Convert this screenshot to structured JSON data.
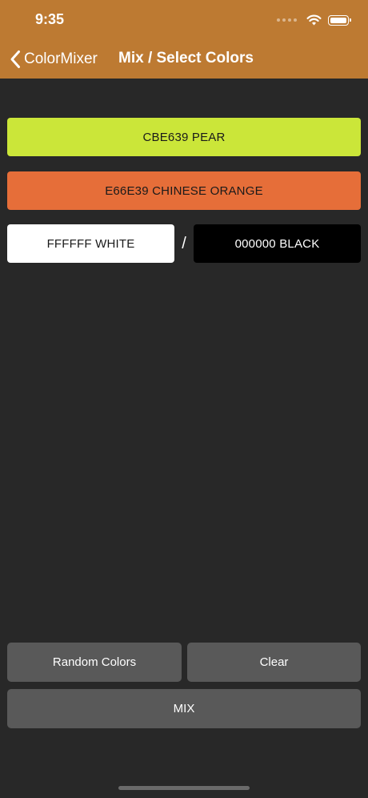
{
  "status_bar": {
    "time": "9:35"
  },
  "nav": {
    "back_label": "ColorMixer",
    "title": "Mix / Select Colors",
    "background": "#bd7a32"
  },
  "colors": {
    "first": {
      "label": "CBE639 PEAR",
      "hex": "#cbe639",
      "text_color": "#1a1a1a"
    },
    "second": {
      "label": "E66E39 CHINESE ORANGE",
      "hex": "#e66e39",
      "text_color": "#1a1a1a"
    },
    "white": {
      "label": "FFFFFF WHITE",
      "hex": "#ffffff",
      "text_color": "#1a1a1a"
    },
    "separator": "/",
    "black": {
      "label": "000000 BLACK",
      "hex": "#000000",
      "text_color": "#ffffff"
    }
  },
  "actions": {
    "random_label": "Random Colors",
    "clear_label": "Clear",
    "mix_label": "MIX",
    "button_color": "#595959"
  },
  "icons": {
    "back": "chevron-left-icon",
    "signal": "signal-icon",
    "wifi": "wifi-icon",
    "battery": "battery-icon"
  }
}
